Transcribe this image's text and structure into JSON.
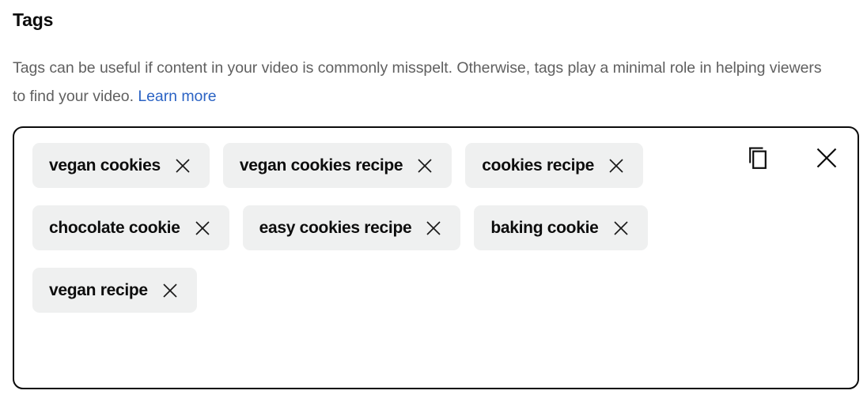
{
  "section": {
    "title": "Tags",
    "description_before_link": "Tags can be useful if content in your video is commonly misspelt. Otherwise, tags play a minimal role in helping viewers to find your video. ",
    "learn_more_label": "Learn more",
    "learn_more_color": "#2b63c4",
    "description_color": "#606060"
  },
  "tag_box": {
    "border_color": "#0b0b0b",
    "chip_background": "#eff0f0",
    "chip_text_color": "#0d0d0d",
    "actions": [
      {
        "name": "copy-icon",
        "label": "Copy tags"
      },
      {
        "name": "close-icon",
        "label": "Clear all tags"
      }
    ],
    "tags": [
      {
        "label": "vegan cookies",
        "remove_icon": "close-icon"
      },
      {
        "label": "vegan cookies recipe",
        "remove_icon": "close-icon"
      },
      {
        "label": "cookies recipe",
        "remove_icon": "close-icon"
      },
      {
        "label": "chocolate cookie",
        "remove_icon": "close-icon"
      },
      {
        "label": "easy cookies recipe",
        "remove_icon": "close-icon"
      },
      {
        "label": "baking cookie",
        "remove_icon": "close-icon"
      },
      {
        "label": "vegan recipe",
        "remove_icon": "close-icon"
      }
    ]
  }
}
